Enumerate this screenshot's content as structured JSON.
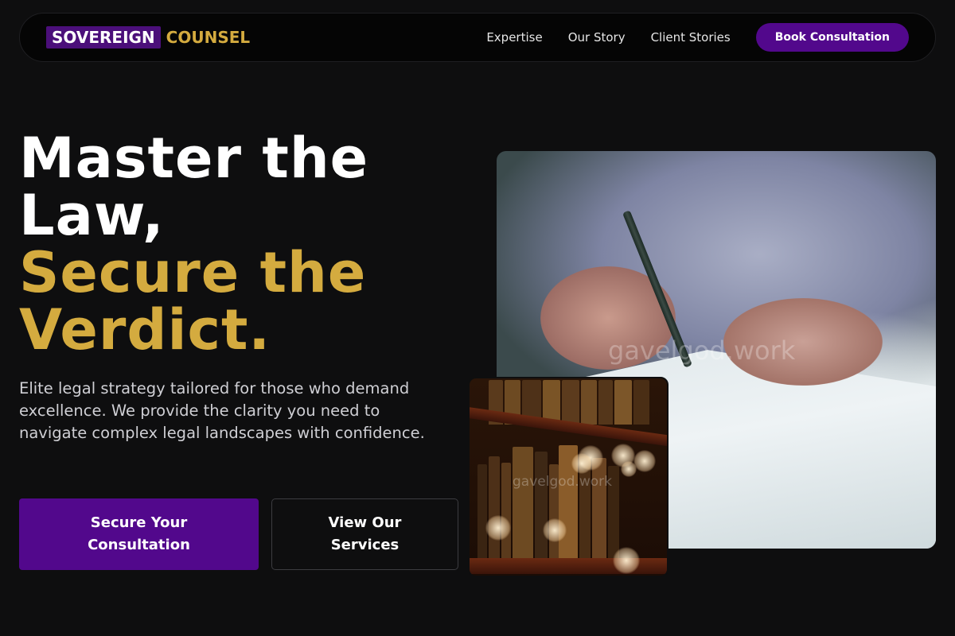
{
  "brand": {
    "mark": "SOVEREIGN",
    "word": "COUNSEL"
  },
  "nav": {
    "links": [
      "Expertise",
      "Our Story",
      "Client Stories"
    ],
    "cta": "Book Consultation"
  },
  "hero": {
    "title_line1": "Master the",
    "title_line2": "Law,",
    "accent_line1": "Secure the",
    "accent_line2": "Verdict.",
    "lead": "Elite legal strategy tailored for those who demand excellence. We provide the clarity you need to navigate complex legal landscapes with confidence.",
    "primary_cta": "Secure Your Consultation",
    "secondary_cta": "View Our Services"
  },
  "images": {
    "main_watermark": "gavelgod.work",
    "books_watermark": "gavelgod.work"
  },
  "colors": {
    "background": "#0e0e0f",
    "accent_gold": "#d4ab3f",
    "brand_purple": "#52088c"
  }
}
